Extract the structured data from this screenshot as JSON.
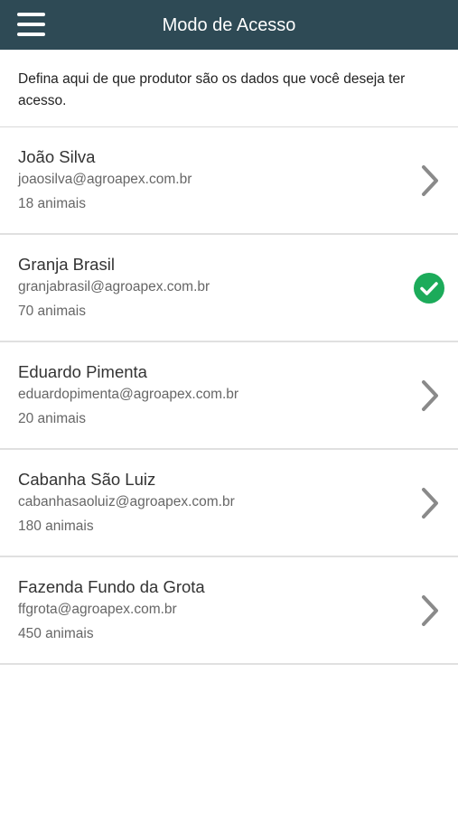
{
  "header": {
    "title": "Modo de Acesso",
    "menu_icon": "hamburger-menu-icon",
    "background": "#2e4a55"
  },
  "intro": {
    "text": "Defina aqui de que produtor são os dados que você deseja ter acesso."
  },
  "producers": [
    {
      "name": "João Silva",
      "email": "joaosilva@agroapex.com.br",
      "animals": "18 animais",
      "selected": false,
      "icon": "chevron-right-icon"
    },
    {
      "name": "Granja Brasil",
      "email": "granjabrasil@agroapex.com.br",
      "animals": "70 animais",
      "selected": true,
      "icon": "check-circle-icon"
    },
    {
      "name": "Eduardo Pimenta",
      "email": "eduardopimenta@agroapex.com.br",
      "animals": "20 animais",
      "selected": false,
      "icon": "chevron-right-icon"
    },
    {
      "name": "Cabanha São Luiz",
      "email": "cabanhasaoluiz@agroapex.com.br",
      "animals": "180 animais",
      "selected": false,
      "icon": "chevron-right-icon"
    },
    {
      "name": "Fazenda Fundo da Grota",
      "email": "ffgrota@agroapex.com.br",
      "animals": "450 animais",
      "selected": false,
      "icon": "chevron-right-icon"
    }
  ],
  "colors": {
    "header": "#2e4a55",
    "selected_check": "#1cab5a",
    "chevron": "#8a8a8a"
  }
}
